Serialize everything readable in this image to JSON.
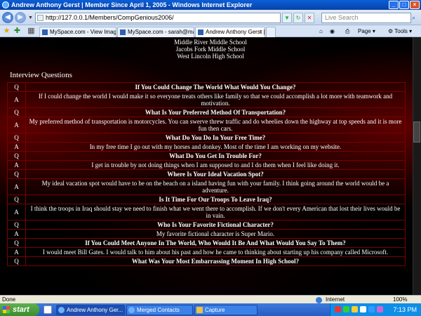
{
  "window": {
    "title": "Andrew Anthony Gerst | Member Since April 1, 2005 - Windows Internet Explorer",
    "controls": {
      "minimize": "_",
      "maximize": "□",
      "close": "×"
    }
  },
  "address_bar": {
    "url": "http://127.0.0.1/Members/CompGenious2006/",
    "search_placeholder": "Live Search"
  },
  "tabs": [
    {
      "label": "MySpace.com - View Image -..."
    },
    {
      "label": "MySpace.com - sarah@marie..."
    },
    {
      "label": "Andrew Anthony Gerst | ..."
    }
  ],
  "command_bar": {
    "page": "Page",
    "tools": "Tools"
  },
  "schools": [
    "Middle River Middle School",
    "Jacobs Fork Middle School",
    "West Lincoln High School"
  ],
  "interview": {
    "heading": "Interview Questions",
    "q_label": "Q",
    "a_label": "A",
    "items": [
      {
        "q": "If You Could Change The World What Would You Change?",
        "a": "If I could change the world I would make it so everyone treats others like family so that we could accomplish a lot more with teamwork and motivation."
      },
      {
        "q": "What Is Your Preferred Method Of Transportation?",
        "a": "My preferred method of transportation is motorcycles. You can swerve threw traffic and do wheelies down the highway at top speeds and it is more fun then cars."
      },
      {
        "q": "What Do You Do In Your Free Time?",
        "a": "In my free time I go out with my horses and donkey. Most of the time I am working on my website."
      },
      {
        "q": "What Do You Get In Trouble For?",
        "a": "I get in trouble by not doing things when I am supposed to and I do them when I feel like doing it."
      },
      {
        "q": "Where Is Your Ideal Vacation Spot?",
        "a": "My ideal vacation spot would have to be on the beach on a island having fun with your family. I think going around the world would be a adventure."
      },
      {
        "q": "Is It Time For Our Troops To Leave Iraq?",
        "a": "I think the troops in Iraq should stay we need to finish what we went there to accomplish. If we don't every American that lost their lives would be in vain."
      },
      {
        "q": "Who Is Your Favorite Fictional Character?",
        "a": "My favorite fictional character is Super Mario."
      },
      {
        "q": "If You Could Meet Anyone In The World, Who Would It Be And What Would You Say To Them?",
        "a": "I would meet Bill Gates. I would talk to him about his past and how he came to thinking about starting up his company called Microsoft."
      },
      {
        "q": "What Was Your Most Embarrassing Moment In High School?",
        "a": ""
      }
    ]
  },
  "status_bar": {
    "status": "Done",
    "zone": "Internet",
    "zoom": "100%"
  },
  "taskbar": {
    "start": "start",
    "buttons": [
      "Andrew Anthony Ger...",
      "Merged Contacts",
      "Capture"
    ],
    "clock": "7:13 PM"
  }
}
